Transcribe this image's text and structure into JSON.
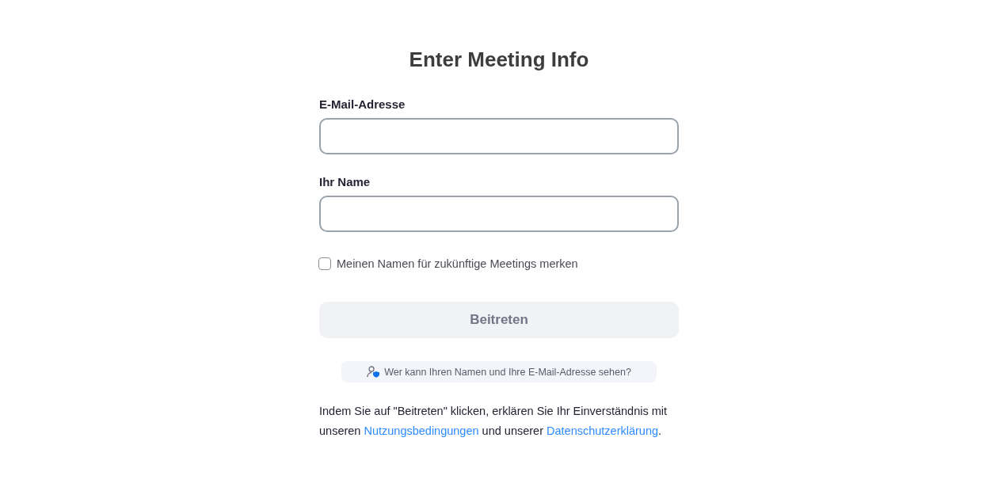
{
  "title": "Enter Meeting Info",
  "fields": [
    {
      "label": "E-Mail-Adresse"
    },
    {
      "label": "Ihr Name"
    }
  ],
  "remember": {
    "label": "Meinen Namen für zukünftige Meetings merken",
    "checked": false
  },
  "join_button": {
    "label": "Beitreten",
    "disabled": true
  },
  "privacy_hint": "Wer kann Ihren Namen und Ihre E-Mail-Adresse sehen?",
  "legal": [
    {
      "kind": "text",
      "text": "Indem Sie auf \"Beitreten\" klicken, erklären Sie Ihr Einverständnis mit unseren "
    },
    {
      "kind": "link",
      "text": "Nutzungsbedingungen"
    },
    {
      "kind": "text",
      "text": " und unserer "
    },
    {
      "kind": "link",
      "text": "Datenschutzerklärung"
    },
    {
      "kind": "text",
      "text": "."
    }
  ]
}
